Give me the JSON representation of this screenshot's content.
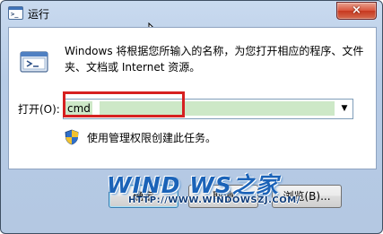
{
  "window": {
    "title": "运行",
    "close_symbol": "×"
  },
  "dialog": {
    "description": "Windows 将根据您所输入的名称，为您打开相应的程序、文件夹、文档或 Internet 资源。",
    "open_label": "打开(O):",
    "open_value": "cmd",
    "admin_note": "使用管理权限创建此任务。"
  },
  "buttons": {
    "ok": "确定",
    "cancel": "取消",
    "browse": "浏览(B)..."
  },
  "watermark": {
    "logo": "WIND  WS之家",
    "url": "HTTP://WWW.WINDOWSZJ.COM/"
  },
  "colors": {
    "highlight": "#d62020",
    "selection": "#cde8c7",
    "watermark_blue": "#1b63b8"
  }
}
